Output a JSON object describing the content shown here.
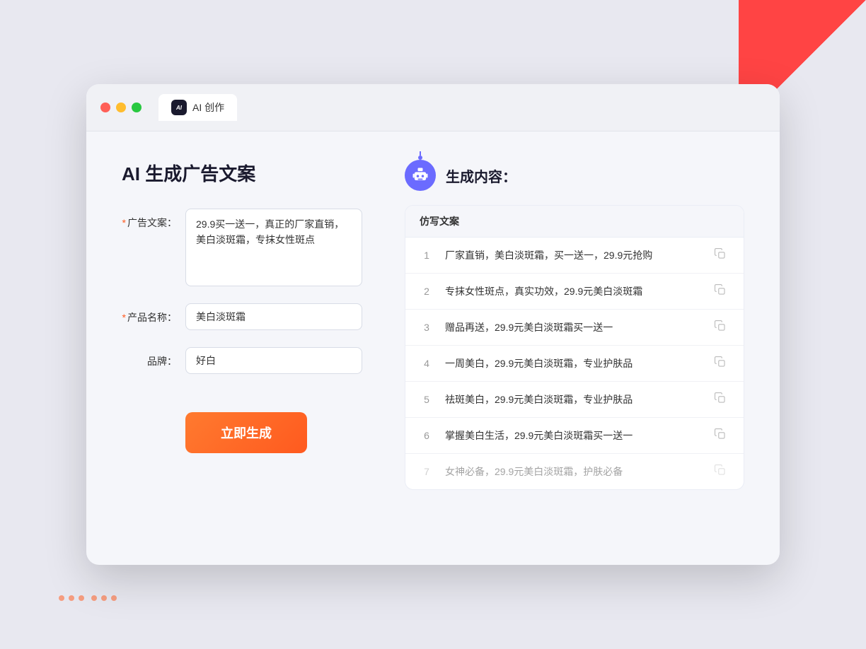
{
  "window": {
    "tab_label": "AI 创作"
  },
  "header": {
    "title": "AI 生成广告文案"
  },
  "form": {
    "ad_copy_label": "广告文案：",
    "ad_copy_required": "*",
    "ad_copy_value": "29.9买一送一，真正的厂家直销，美白淡斑霜，专抹女性斑点",
    "product_name_label": "产品名称：",
    "product_name_required": "*",
    "product_name_value": "美白淡斑霜",
    "brand_label": "品牌：",
    "brand_value": "好白",
    "generate_button": "立即生成"
  },
  "result": {
    "header_icon": "robot",
    "title": "生成内容：",
    "table_header": "仿写文案",
    "items": [
      {
        "num": "1",
        "text": "厂家直销，美白淡斑霜，买一送一，29.9元抢购",
        "dimmed": false
      },
      {
        "num": "2",
        "text": "专抹女性斑点，真实功效，29.9元美白淡斑霜",
        "dimmed": false
      },
      {
        "num": "3",
        "text": "赠品再送，29.9元美白淡斑霜买一送一",
        "dimmed": false
      },
      {
        "num": "4",
        "text": "一周美白，29.9元美白淡斑霜，专业护肤品",
        "dimmed": false
      },
      {
        "num": "5",
        "text": "祛斑美白，29.9元美白淡斑霜，专业护肤品",
        "dimmed": false
      },
      {
        "num": "6",
        "text": "掌握美白生活，29.9元美白淡斑霜买一送一",
        "dimmed": false
      },
      {
        "num": "7",
        "text": "女神必备，29.9元美白淡斑霜，护肤必备",
        "dimmed": true
      }
    ]
  }
}
